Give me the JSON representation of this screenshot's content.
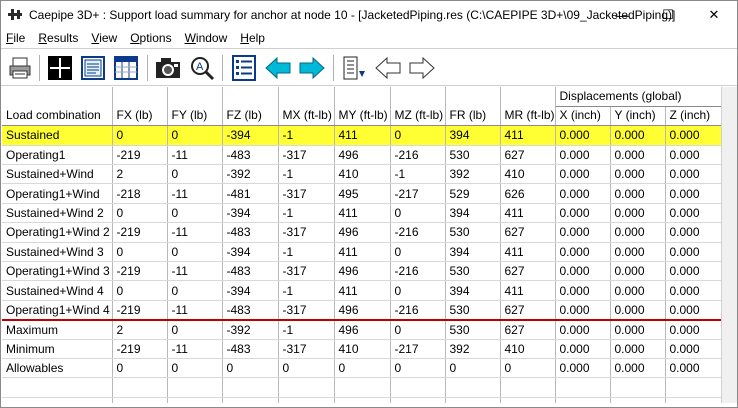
{
  "window": {
    "title": "Caepipe 3D+ : Support load summary for anchor at node 10 -  [JacketedPiping.res (C:\\CAEPIPE 3D+\\09_JacketedPiping)]",
    "controls": {
      "minimize": "—",
      "maximize": "☐",
      "close": "✕"
    }
  },
  "menu": [
    {
      "mnemonic": "F",
      "rest": "ile"
    },
    {
      "mnemonic": "R",
      "rest": "esults"
    },
    {
      "mnemonic": "V",
      "rest": "iew"
    },
    {
      "mnemonic": "O",
      "rest": "ptions"
    },
    {
      "mnemonic": "W",
      "rest": "indow"
    },
    {
      "mnemonic": "H",
      "rest": "elp"
    }
  ],
  "toolbar": {
    "icons": [
      "printer-icon",
      "crosshair-icon",
      "text-view-icon",
      "table-view-icon",
      "camera-icon",
      "zoom-icon",
      "list-icon",
      "arrow-left-icon",
      "arrow-right-icon",
      "sort-icon",
      "outline-arrow-left-icon",
      "outline-arrow-right-icon"
    ],
    "colors": {
      "accent_arrow": "#00b8d8",
      "selection_row": "#ffff33",
      "divider_line": "#c00000"
    }
  },
  "table": {
    "group_header": "Displacements (global)",
    "columns": [
      "Load combination",
      "FX (lb)",
      "FY (lb)",
      "FZ (lb)",
      "MX (ft-lb)",
      "MY (ft-lb)",
      "MZ (ft-lb)",
      "FR (lb)",
      "MR (ft-lb)",
      "X (inch)",
      "Y (inch)",
      "Z (inch)"
    ],
    "rows": [
      {
        "name": "Sustained",
        "fx": "0",
        "fy": "0",
        "fz": "-394",
        "mx": "-1",
        "my": "411",
        "mz": "0",
        "fr": "394",
        "mr": "411",
        "x": "0.000",
        "y": "0.000",
        "z": "0.000"
      },
      {
        "name": "Operating1",
        "fx": "-219",
        "fy": "-11",
        "fz": "-483",
        "mx": "-317",
        "my": "496",
        "mz": "-216",
        "fr": "530",
        "mr": "627",
        "x": "0.000",
        "y": "0.000",
        "z": "0.000"
      },
      {
        "name": "Sustained+Wind",
        "fx": "2",
        "fy": "0",
        "fz": "-392",
        "mx": "-1",
        "my": "410",
        "mz": "-1",
        "fr": "392",
        "mr": "410",
        "x": "0.000",
        "y": "0.000",
        "z": "0.000"
      },
      {
        "name": "Operating1+Wind",
        "fx": "-218",
        "fy": "-11",
        "fz": "-481",
        "mx": "-317",
        "my": "495",
        "mz": "-217",
        "fr": "529",
        "mr": "626",
        "x": "0.000",
        "y": "0.000",
        "z": "0.000"
      },
      {
        "name": "Sustained+Wind 2",
        "fx": "0",
        "fy": "0",
        "fz": "-394",
        "mx": "-1",
        "my": "411",
        "mz": "0",
        "fr": "394",
        "mr": "411",
        "x": "0.000",
        "y": "0.000",
        "z": "0.000"
      },
      {
        "name": "Operating1+Wind 2",
        "fx": "-219",
        "fy": "-11",
        "fz": "-483",
        "mx": "-317",
        "my": "496",
        "mz": "-216",
        "fr": "530",
        "mr": "627",
        "x": "0.000",
        "y": "0.000",
        "z": "0.000"
      },
      {
        "name": "Sustained+Wind 3",
        "fx": "0",
        "fy": "0",
        "fz": "-394",
        "mx": "-1",
        "my": "411",
        "mz": "0",
        "fr": "394",
        "mr": "411",
        "x": "0.000",
        "y": "0.000",
        "z": "0.000"
      },
      {
        "name": "Operating1+Wind 3",
        "fx": "-219",
        "fy": "-11",
        "fz": "-483",
        "mx": "-317",
        "my": "496",
        "mz": "-216",
        "fr": "530",
        "mr": "627",
        "x": "0.000",
        "y": "0.000",
        "z": "0.000"
      },
      {
        "name": "Sustained+Wind 4",
        "fx": "0",
        "fy": "0",
        "fz": "-394",
        "mx": "-1",
        "my": "411",
        "mz": "0",
        "fr": "394",
        "mr": "411",
        "x": "0.000",
        "y": "0.000",
        "z": "0.000"
      },
      {
        "name": "Operating1+Wind 4",
        "fx": "-219",
        "fy": "-11",
        "fz": "-483",
        "mx": "-317",
        "my": "496",
        "mz": "-216",
        "fr": "530",
        "mr": "627",
        "x": "0.000",
        "y": "0.000",
        "z": "0.000"
      },
      {
        "name": "Maximum",
        "fx": "2",
        "fy": "0",
        "fz": "-392",
        "mx": "-1",
        "my": "496",
        "mz": "0",
        "fr": "530",
        "mr": "627",
        "x": "0.000",
        "y": "0.000",
        "z": "0.000"
      },
      {
        "name": "Minimum",
        "fx": "-219",
        "fy": "-11",
        "fz": "-483",
        "mx": "-317",
        "my": "410",
        "mz": "-217",
        "fr": "392",
        "mr": "410",
        "x": "0.000",
        "y": "0.000",
        "z": "0.000"
      },
      {
        "name": "Allowables",
        "fx": "0",
        "fy": "0",
        "fz": "0",
        "mx": "0",
        "my": "0",
        "mz": "0",
        "fr": "0",
        "mr": "0",
        "x": "0.000",
        "y": "0.000",
        "z": "0.000"
      }
    ],
    "selected_row": 0,
    "divider_after_row": 9
  }
}
